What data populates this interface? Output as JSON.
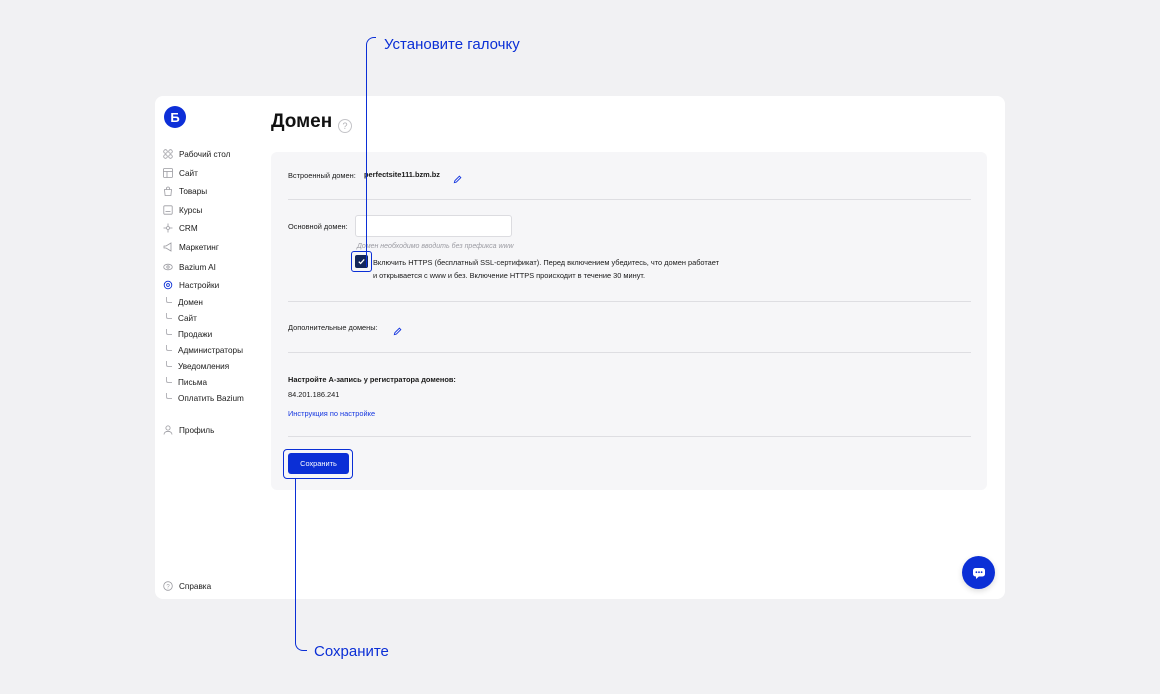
{
  "brand": {
    "logo_letter": "Б",
    "accent": "#0b2fd6"
  },
  "sidebar": {
    "items": [
      {
        "label": "Рабочий стол",
        "icon": "dashboard-icon"
      },
      {
        "label": "Сайт",
        "icon": "layout-icon"
      },
      {
        "label": "Товары",
        "icon": "bag-icon"
      },
      {
        "label": "Курсы",
        "icon": "book-icon"
      },
      {
        "label": "CRM",
        "icon": "crm-icon"
      },
      {
        "label": "Маркетинг",
        "icon": "megaphone-icon"
      },
      {
        "label": "Bazium AI",
        "icon": "ai-icon"
      },
      {
        "label": "Настройки",
        "icon": "gear-icon"
      }
    ],
    "settings_subitems": [
      "Домен",
      "Сайт",
      "Продажи",
      "Администраторы",
      "Уведомления",
      "Письма",
      "Оплатить Bazium"
    ],
    "profile": {
      "label": "Профиль",
      "icon": "user-icon"
    },
    "help": {
      "label": "Справка",
      "icon": "help-icon"
    }
  },
  "page": {
    "title": "Домен",
    "help_icon": "?"
  },
  "form": {
    "builtin_domain_label": "Встроенный домен:",
    "builtin_domain_value": "perfectsite111.bzm.bz",
    "main_domain_label": "Основной домен:",
    "main_domain_value": "",
    "main_domain_hint": "Домен необходимо вводить без префикса www",
    "https_checked": true,
    "https_text_line1": "Включить HTTPS (бесплатный SSL-сертификат). Перед включением убедитесь, что домен работает",
    "https_text_line2": "и открывается с www и без. Включение HTTPS происходит в течение 30 минут.",
    "extra_domains_label": "Дополнительные домены:",
    "a_record_title": "Настройте A-запись у регистратора доменов:",
    "a_record_ip": "84.201.186.241",
    "instruction_link": "Инструкция по настройке",
    "save_label": "Сохранить"
  },
  "annotations": {
    "top": "Установите галочку",
    "bottom": "Сохраните"
  }
}
